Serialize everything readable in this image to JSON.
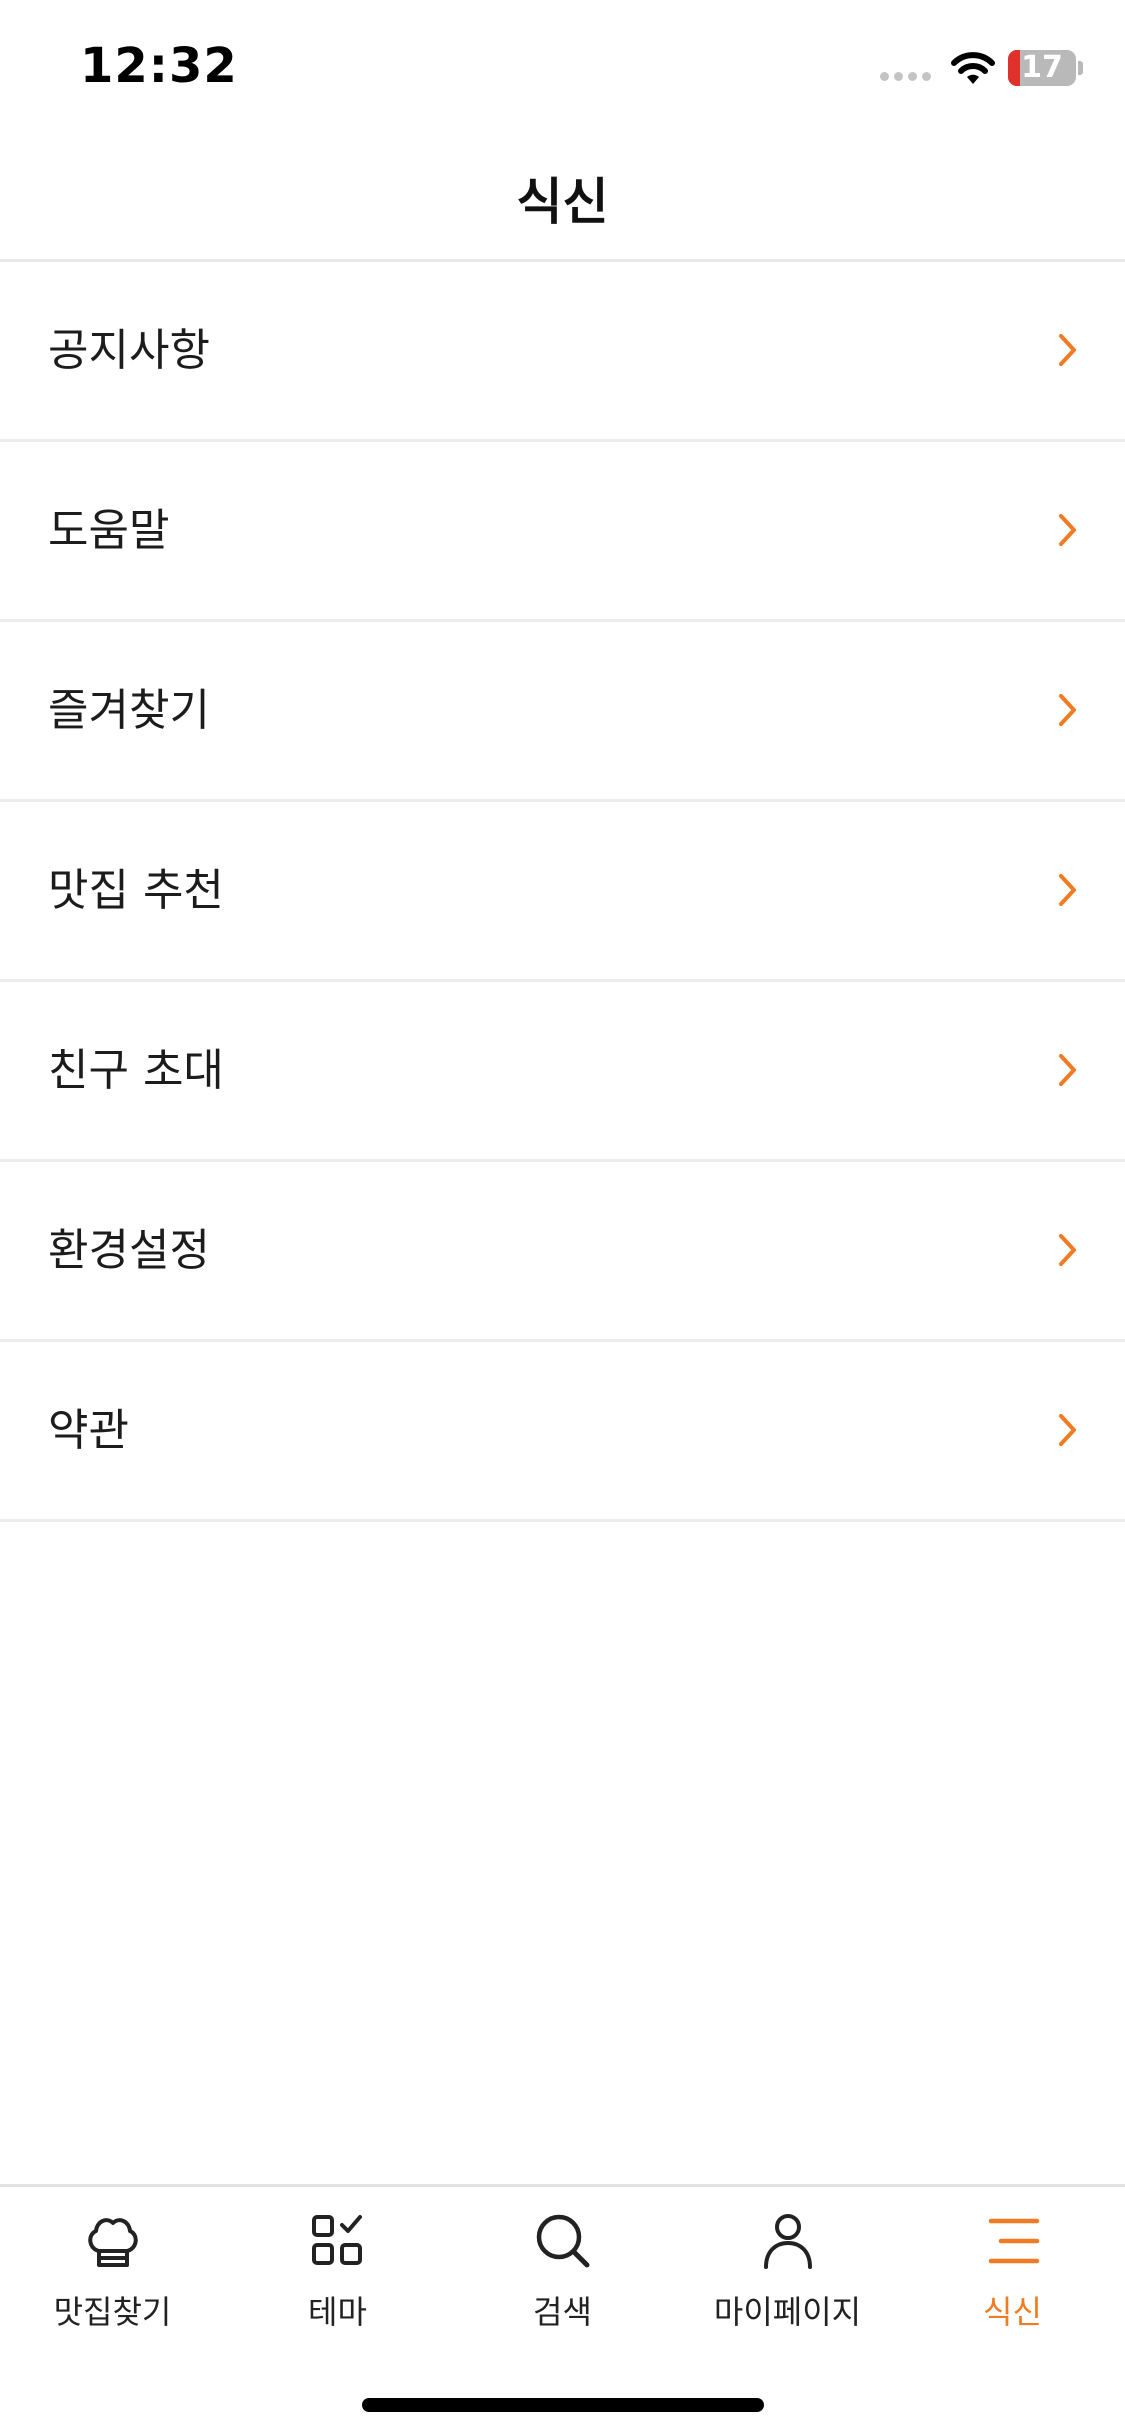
{
  "status_bar": {
    "time": "12:32",
    "battery_level": "17",
    "battery_fraction": 0.17
  },
  "header": {
    "title": "식신"
  },
  "menu": {
    "items": [
      {
        "label": "공지사항"
      },
      {
        "label": "도움말"
      },
      {
        "label": "즐겨찾기"
      },
      {
        "label": "맛집 추천"
      },
      {
        "label": "친구 초대"
      },
      {
        "label": "환경설정"
      },
      {
        "label": "약관"
      }
    ]
  },
  "tab_bar": {
    "items": [
      {
        "label": "맛집찾기",
        "icon": "chef-hat-icon"
      },
      {
        "label": "테마",
        "icon": "grid-check-icon"
      },
      {
        "label": "검색",
        "icon": "search-icon"
      },
      {
        "label": "마이페이지",
        "icon": "person-icon"
      },
      {
        "label": "식신",
        "icon": "menu-lines-icon"
      }
    ],
    "active_index": 4
  },
  "colors": {
    "accent": "#f07b22",
    "text": "#1c1c1c",
    "divider": "#ececec",
    "battery_low": "#e0312b"
  }
}
